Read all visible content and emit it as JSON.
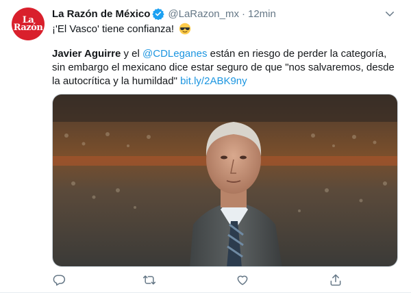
{
  "tweet": {
    "author_name": "La Razón de México",
    "handle": "@LaRazon_mx",
    "separator": "·",
    "time": "12min",
    "first_line": "¡'El Vasco' tiene confianza!",
    "body_bold": "Javier Aguirre",
    "body_y_el": " y el ",
    "mention": "@CDLeganes",
    "body_rest": " están en riesgo de perder la categoría, sin embargo el mexicano dice estar seguro de que \"nos salvaremos, desde la autocrítica y la humildad\" ",
    "link": "bit.ly/2ABK9ny",
    "avatar_logo": "La Razón"
  },
  "icons": {
    "verified": "verified-badge-icon",
    "caret": "chevron-down-icon",
    "emoji": "sunglasses-emoji-icon",
    "reply": "reply-icon",
    "retweet": "retweet-icon",
    "like": "heart-icon",
    "share": "share-icon"
  },
  "colors": {
    "brand_red": "#d9202c",
    "link_blue": "#1b95e0",
    "verified_blue": "#1da1f2",
    "muted_gray": "#657786"
  }
}
